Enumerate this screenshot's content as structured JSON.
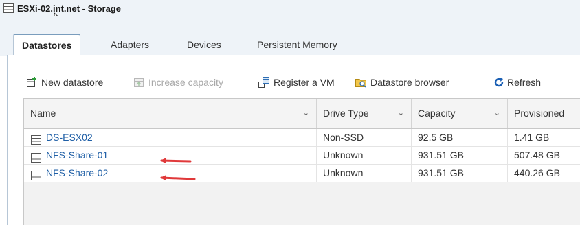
{
  "window": {
    "title": "ESXi-02.int.net - Storage"
  },
  "tabs": [
    {
      "label": "Datastores",
      "active": true
    },
    {
      "label": "Adapters",
      "active": false
    },
    {
      "label": "Devices",
      "active": false
    },
    {
      "label": "Persistent Memory",
      "active": false
    }
  ],
  "toolbar": {
    "new_datastore": "New datastore",
    "increase_capacity": "Increase capacity",
    "register_vm": "Register a VM",
    "datastore_browser": "Datastore browser",
    "refresh": "Refresh"
  },
  "table": {
    "columns": [
      "Name",
      "Drive Type",
      "Capacity",
      "Provisioned"
    ],
    "rows": [
      {
        "name": "DS-ESX02",
        "drive_type": "Non-SSD",
        "capacity": "92.5 GB",
        "provisioned": "1.41 GB",
        "highlighted": false
      },
      {
        "name": "NFS-Share-01",
        "drive_type": "Unknown",
        "capacity": "931.51 GB",
        "provisioned": "507.48 GB",
        "highlighted": true
      },
      {
        "name": "NFS-Share-02",
        "drive_type": "Unknown",
        "capacity": "931.51 GB",
        "provisioned": "440.26 GB",
        "highlighted": true
      }
    ]
  },
  "colors": {
    "link": "#1f5fa6",
    "annotation_arrow": "#e0393a",
    "refresh_icon": "#1a5fb4",
    "title_bar": "#eef3f8"
  },
  "icons": {
    "title": "storage-icon",
    "new_datastore": "new-datastore-icon",
    "increase_capacity": "increase-capacity-icon",
    "register_vm": "register-vm-icon",
    "datastore_browser": "datastore-browser-icon",
    "refresh": "refresh-icon",
    "row": "datastore-icon"
  }
}
